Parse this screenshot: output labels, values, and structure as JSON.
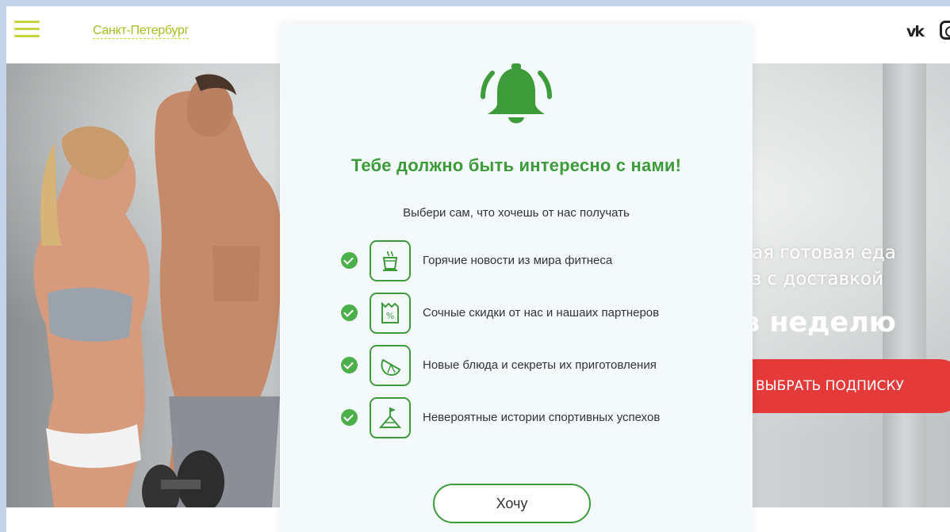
{
  "header": {
    "city": "Санкт-Петербург",
    "social": {
      "vk": "ѡк"
    }
  },
  "hero": {
    "line1": "ая готовая еда",
    "line2": "з с доставкой",
    "line3": "в неделю",
    "cta": "ВЫБРАТЬ ПОДПИСКУ"
  },
  "modal": {
    "title": "Тебе должно быть интересно с нами!",
    "subtitle": "Выбери сам, что хочешь от нас получать",
    "options": [
      {
        "icon": "coffee-cup-icon",
        "label": "Горячие новости из мира фитнеса"
      },
      {
        "icon": "discount-receipt-icon",
        "label": "Сочные скидки от нас и нашаих партнеров"
      },
      {
        "icon": "lemon-slice-icon",
        "label": "Новые блюда и секреты их приготовления"
      },
      {
        "icon": "summit-flag-icon",
        "label": "Невероятные истории спортивных успехов"
      }
    ],
    "button": "Хочу"
  },
  "colors": {
    "accent_green": "#3d9b3a",
    "check_green": "#4bb04a",
    "city_yellow": "#a9bb22",
    "cta_red": "#e53a3a",
    "frame_blue": "#c3d3ea"
  }
}
